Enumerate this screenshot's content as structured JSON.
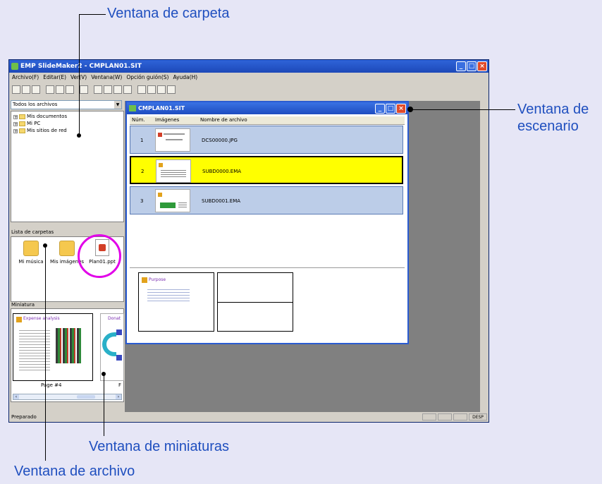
{
  "callouts": {
    "folder_window": "Ventana de carpeta",
    "scenario_window_line1": "Ventana de",
    "scenario_window_line2": "escenario",
    "thumbnail_window": "Ventana de miniaturas",
    "file_window": "Ventana de archivo"
  },
  "app": {
    "title": "EMP SlideMaker2 - CMPLAN01.SIT",
    "menu": [
      "Archivo(F)",
      "Editar(E)",
      "Ver(V)",
      "Ventana(W)",
      "Opción guión(S)",
      "Ayuda(H)"
    ]
  },
  "folder_pane": {
    "combo_value": "Todos los archivos",
    "tree": [
      "Mis documentos",
      "Mi PC",
      "Mis sitios de red"
    ]
  },
  "file_pane": {
    "label": "Lista de carpetas",
    "items": [
      "Mi música",
      "Mis imágenes",
      "Plan01.ppt"
    ]
  },
  "thumb_pane": {
    "label": "Miniatura",
    "slide1_title": "Expense analysis",
    "slide2_title": "Donat",
    "page_label": "Page #4",
    "page_label2": "F"
  },
  "scenario": {
    "title": "CMPLAN01.SIT",
    "headers": [
      "Núm.",
      "Imágenes",
      "Nombre de archivo"
    ],
    "rows": [
      {
        "num": "1",
        "file": "DCS00000.JPG",
        "color": "#bccde8"
      },
      {
        "num": "2",
        "file": "SUBD0000.EMA",
        "color": "#ffff00"
      },
      {
        "num": "3",
        "file": "SUBD0001.EMA",
        "color": "#bccde8"
      }
    ],
    "preview_title": "Purpose"
  },
  "status": {
    "text": "Preparado",
    "indicator": "DESP"
  }
}
